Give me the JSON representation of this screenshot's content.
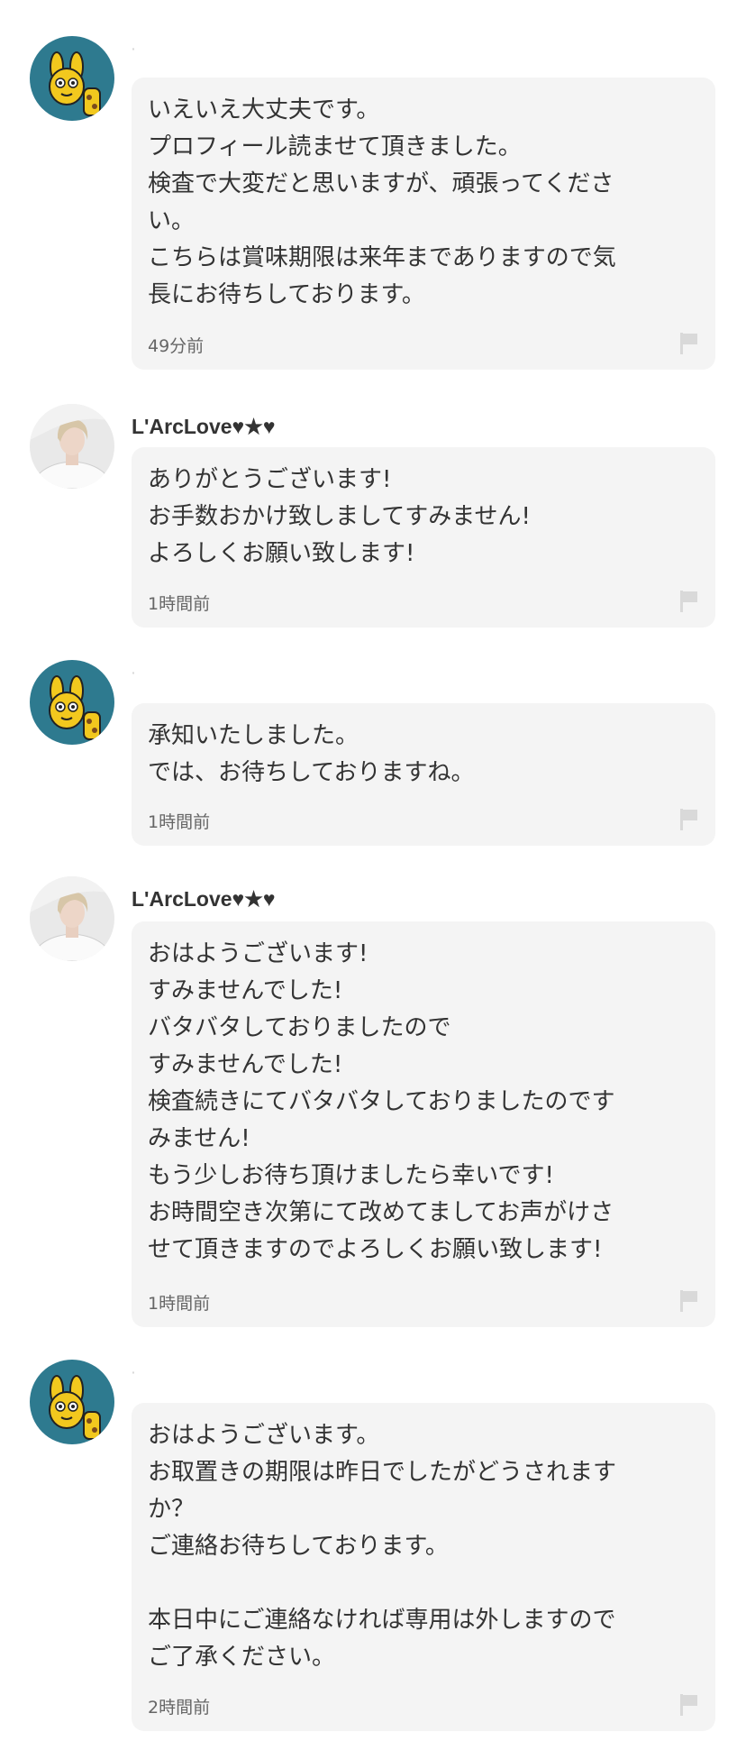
{
  "comments": [
    {
      "username": "·",
      "avatar": "giraffe-avatar",
      "body": "いえいえ大丈夫です。\nプロフィール読ませて頂きました。\n検査で大変だと思いますが、頑張ってくださ\nい。\nこちらは賞味期限は来年までありますので気\n長にお待ちしております。",
      "time": "49分前"
    },
    {
      "username": "L'ArcLove♥★♥",
      "avatar": "person-avatar",
      "body": "ありがとうございます!\nお手数おかけ致しましてすみません!\nよろしくお願い致します!",
      "time": "1時間前"
    },
    {
      "username": "·",
      "avatar": "giraffe-avatar",
      "body": "承知いたしました。\nでは、お待ちしておりますね。",
      "time": "1時間前"
    },
    {
      "username": "L'ArcLove♥★♥",
      "avatar": "person-avatar",
      "body": "おはようございます!\nすみませんでした!\nバタバタしておりましたので\nすみませんでした!\n検査続きにてバタバタしておりましたのです\nみません!\nもう少しお待ち頂けましたら幸いです!\nお時間空き次第にて改めてましてお声がけさ\nせて頂きますのでよろしくお願い致します!",
      "time": "1時間前"
    },
    {
      "username": "·",
      "avatar": "giraffe-avatar",
      "body": "おはようございます。\nお取置きの期限は昨日でしたがどうされます\nか？\nご連絡お待ちしております。\n\n本日中にご連絡なければ専用は外しますので\nご了承ください。",
      "time": "2時間前"
    }
  ],
  "icons": {
    "report": "flag-icon"
  },
  "colors": {
    "bubble_bg": "#f4f4f4",
    "text": "#333333",
    "meta_text": "#666666",
    "flag": "#d9d9d9",
    "giraffe_bg": "#2e7a8f"
  }
}
